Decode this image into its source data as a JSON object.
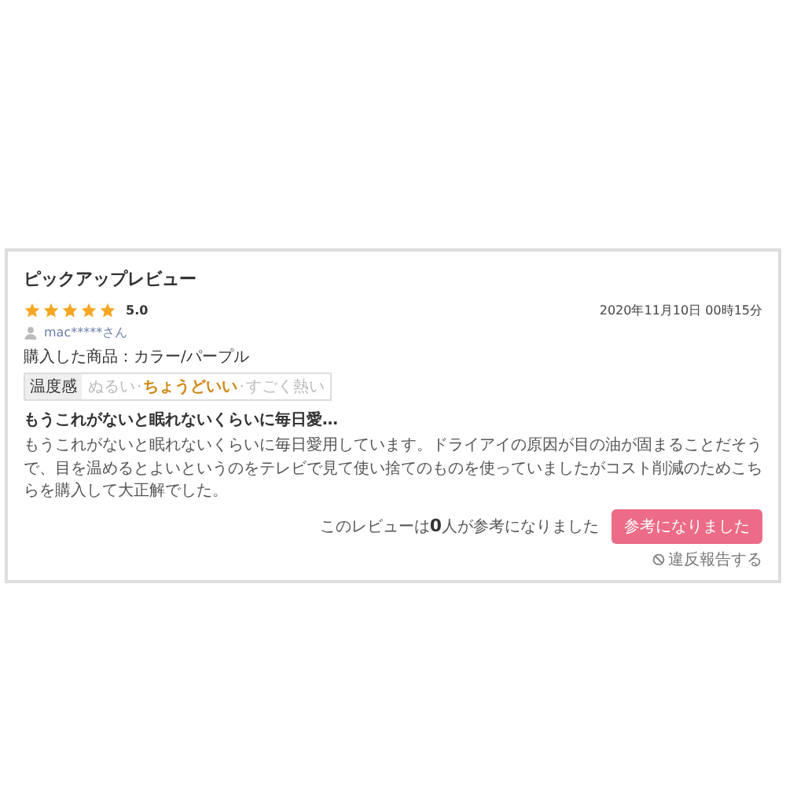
{
  "title": "ピックアップレビュー",
  "rating": {
    "stars": 5,
    "score": "5.0"
  },
  "date": "2020年11月10日 00時15分",
  "reviewer": "mac*****さん",
  "purchase": {
    "label": "購入した商品：",
    "value": "カラー/パープル"
  },
  "scale": {
    "label": "温度感",
    "separator": "·",
    "options": [
      {
        "text": "ぬるい",
        "selected": false
      },
      {
        "text": "ちょうどいい",
        "selected": true
      },
      {
        "text": "すごく熱い",
        "selected": false
      }
    ]
  },
  "review_title": "もうこれがないと眠れないくらいに毎日愛…",
  "review_body": "もうこれがないと眠れないくらいに毎日愛用しています。ドライアイの原因が目の油が固まることだそうで、目を温めるとよいというのをテレビで見て使い捨てのものを使っていましたがコスト削減のためこちらを購入して大正解でした。",
  "helpful_text": "このレビューは**0**人が参考になりました",
  "helpful_button": "参考になりました",
  "report_link": "違反報告する"
}
